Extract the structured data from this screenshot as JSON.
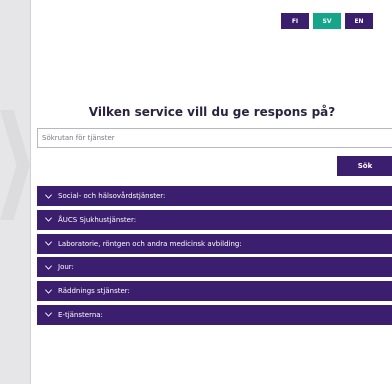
{
  "language_switcher": {
    "options": [
      {
        "label": "FI",
        "active": false
      },
      {
        "label": "SV",
        "active": true
      },
      {
        "label": "EN",
        "active": false
      }
    ]
  },
  "main": {
    "title": "Vilken service vill du ge respons på?",
    "search": {
      "placeholder": "Sökrutan för tjänster",
      "value": "",
      "button_label": "Sök"
    },
    "categories": [
      {
        "label": "Social- och hälsovårdstjänster:",
        "expanded": false
      },
      {
        "label": "ÅUCS Sjukhustjänster:",
        "expanded": false
      },
      {
        "label": "Laboratorie, röntgen och andra medicinsk avbilding:",
        "expanded": false
      },
      {
        "label": "Jour:",
        "expanded": false
      },
      {
        "label": "Räddnings stjänster:",
        "expanded": false
      },
      {
        "label": "E-tjänsterna:",
        "expanded": false
      }
    ]
  },
  "colors": {
    "primary": "#3b1f6e",
    "active_language": "#17a58a",
    "background": "#e6e6e8",
    "panel": "#ffffff",
    "title_text": "#2b2440"
  },
  "icons": {
    "category_toggle": "chevron-down-icon",
    "side_decoration": "chevron-right-icon"
  }
}
